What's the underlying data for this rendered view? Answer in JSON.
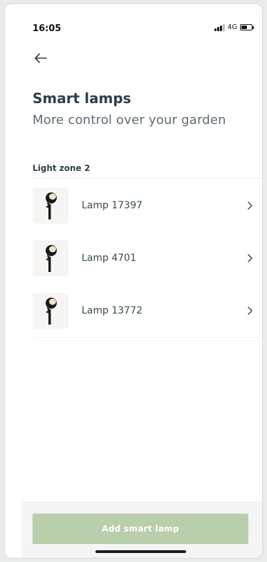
{
  "status": {
    "time": "16:05",
    "network": "4G",
    "signal_bars": 3,
    "battery_level": 0.6
  },
  "header": {
    "back_icon": "arrow-left-icon",
    "title": "Smart lamps",
    "subtitle": "More control over your garden"
  },
  "zone": {
    "label": "Light zone 2",
    "lamps": [
      {
        "label": "Lamp 17397",
        "icon": "garden-spot-lamp-icon",
        "chevron": "chevron-right-icon"
      },
      {
        "label": "Lamp 4701",
        "icon": "garden-spot-lamp-icon",
        "chevron": "chevron-right-icon"
      },
      {
        "label": "Lamp 13772",
        "icon": "garden-spot-lamp-icon",
        "chevron": "chevron-right-icon"
      }
    ]
  },
  "footer": {
    "add_button_label": "Add smart lamp"
  },
  "colors": {
    "primary_button": "#b9cfab",
    "text_dark": "#2f3e46",
    "text_muted": "#5b6b72"
  }
}
